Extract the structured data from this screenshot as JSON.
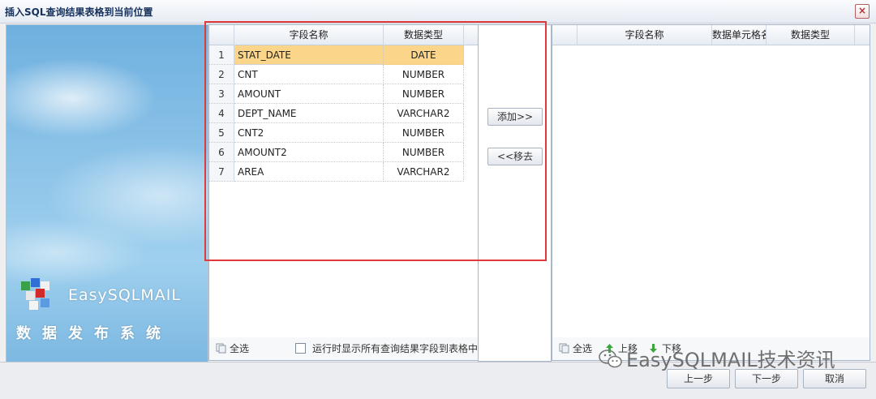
{
  "dialog": {
    "title": "插入SQL查询结果表格到当前位置",
    "close_label": "×"
  },
  "banner": {
    "brand_name": "EasySQLMAIL",
    "brand_sub": "数据发布系统"
  },
  "left_grid": {
    "headers": [
      "字段名称",
      "数据类型"
    ],
    "rows": [
      {
        "num": "1",
        "name": "STAT_DATE",
        "type": "DATE"
      },
      {
        "num": "2",
        "name": "CNT",
        "type": "NUMBER"
      },
      {
        "num": "3",
        "name": "AMOUNT",
        "type": "NUMBER"
      },
      {
        "num": "4",
        "name": "DEPT_NAME",
        "type": "VARCHAR2"
      },
      {
        "num": "5",
        "name": "CNT2",
        "type": "NUMBER"
      },
      {
        "num": "6",
        "name": "AMOUNT2",
        "type": "NUMBER"
      },
      {
        "num": "7",
        "name": "AREA",
        "type": "VARCHAR2"
      }
    ],
    "select_all": "全选",
    "show_all_checkbox": "运行时显示所有查询结果字段到表格中"
  },
  "middle": {
    "add_button": "添加>>",
    "remove_button": "<<移去"
  },
  "right_grid": {
    "headers": [
      "字段名称",
      "数据单元格名",
      "数据类型"
    ],
    "select_all": "全选",
    "move_up": "上移",
    "move_down": "下移"
  },
  "footer": {
    "prev_button": "上一步",
    "next_button": "下一步",
    "cancel_button": "取消"
  },
  "watermark": "EasySQLMAIL技术资讯",
  "colors": {
    "highlight": "#e03a3a",
    "selected_row": "#fbd68a",
    "banner_sky": "#8cc3e8"
  }
}
